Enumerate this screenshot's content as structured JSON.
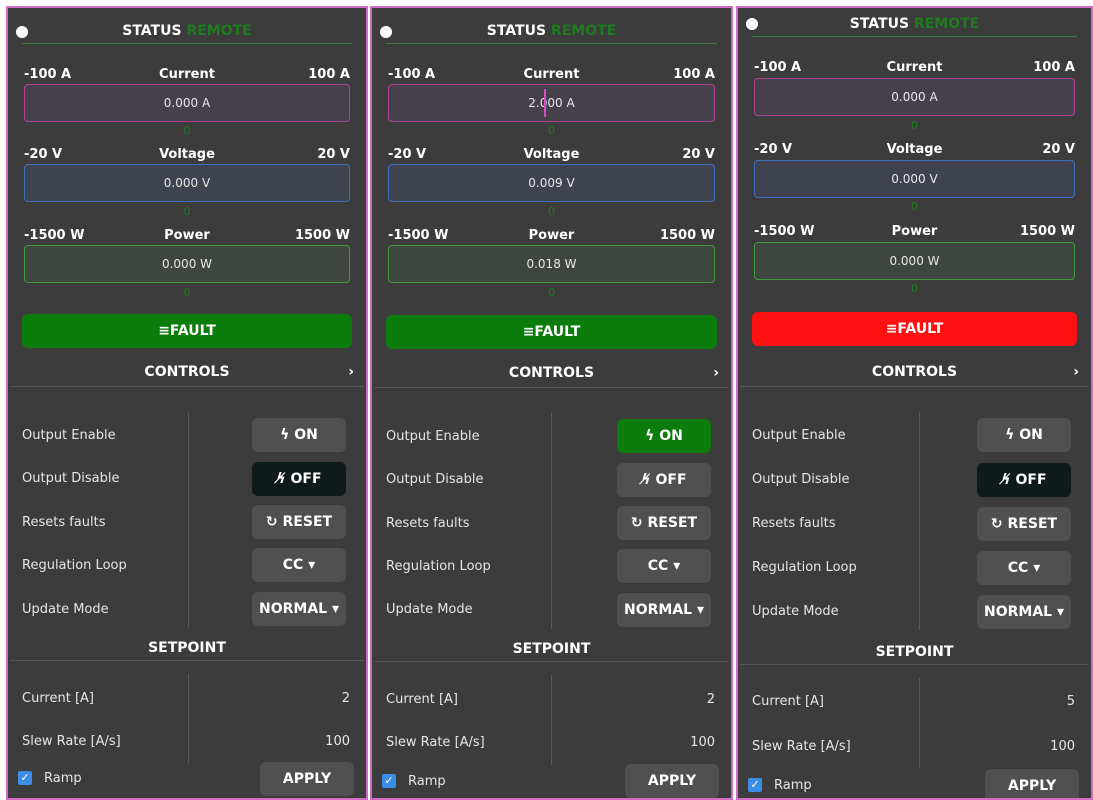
{
  "panels": [
    {
      "status": {
        "title": "STATUS",
        "mode": "REMOTE"
      },
      "gauges": [
        {
          "min": "-100 A",
          "title": "Current",
          "max": "100 A",
          "value": "0.000 A",
          "zero": "0"
        },
        {
          "min": "-20 V",
          "title": "Voltage",
          "max": "20 V",
          "value": "0.000 V",
          "zero": "0"
        },
        {
          "min": "-1500 W",
          "title": "Power",
          "max": "1500 W",
          "value": "0.000 W",
          "zero": "0"
        }
      ],
      "fault": {
        "label": "FAULT",
        "icon": "list-icon",
        "color": "#0c7c0c"
      },
      "controls": {
        "title": "CONTROLS",
        "rows": [
          {
            "label": "Output Enable",
            "button": "ON",
            "icon": "bolt-icon"
          },
          {
            "label": "Output Disable",
            "button": "OFF",
            "icon": "bolt-off-icon"
          },
          {
            "label": "Resets faults",
            "button": "RESET",
            "icon": "reset-icon"
          },
          {
            "label": "Regulation Loop",
            "button": "CC",
            "icon": "caret-down-icon"
          },
          {
            "label": "Update Mode",
            "button": "NORMAL",
            "icon": "caret-down-icon"
          }
        ],
        "active": "OFF"
      },
      "setpoint": {
        "title": "SETPOINT",
        "rows": [
          {
            "label": "Current [A]",
            "value": "2"
          },
          {
            "label": "Slew Rate [A/s]",
            "value": "100"
          }
        ],
        "ramp_label": "Ramp",
        "ramp_checked": true,
        "apply": "APPLY"
      }
    },
    {
      "status": {
        "title": "STATUS",
        "mode": "REMOTE"
      },
      "gauges": [
        {
          "min": "-100 A",
          "title": "Current",
          "max": "100 A",
          "value": "2.000 A",
          "zero": "0"
        },
        {
          "min": "-20 V",
          "title": "Voltage",
          "max": "20 V",
          "value": "0.009 V",
          "zero": "0"
        },
        {
          "min": "-1500 W",
          "title": "Power",
          "max": "1500 W",
          "value": "0.018 W",
          "zero": "0"
        }
      ],
      "fault": {
        "label": "FAULT",
        "icon": "list-icon",
        "color": "#0c7c0c"
      },
      "controls": {
        "title": "CONTROLS",
        "rows": [
          {
            "label": "Output Enable",
            "button": "ON",
            "icon": "bolt-icon"
          },
          {
            "label": "Output Disable",
            "button": "OFF",
            "icon": "bolt-off-icon"
          },
          {
            "label": "Resets faults",
            "button": "RESET",
            "icon": "reset-icon"
          },
          {
            "label": "Regulation Loop",
            "button": "CC",
            "icon": "caret-down-icon"
          },
          {
            "label": "Update Mode",
            "button": "NORMAL",
            "icon": "caret-down-icon"
          }
        ],
        "active": "ON"
      },
      "setpoint": {
        "title": "SETPOINT",
        "rows": [
          {
            "label": "Current [A]",
            "value": "2"
          },
          {
            "label": "Slew Rate [A/s]",
            "value": "100"
          }
        ],
        "ramp_label": "Ramp",
        "ramp_checked": true,
        "apply": "APPLY"
      }
    },
    {
      "status": {
        "title": "STATUS",
        "mode": "REMOTE"
      },
      "gauges": [
        {
          "min": "-100 A",
          "title": "Current",
          "max": "100 A",
          "value": "0.000 A",
          "zero": "0"
        },
        {
          "min": "-20 V",
          "title": "Voltage",
          "max": "20 V",
          "value": "0.000 V",
          "zero": "0"
        },
        {
          "min": "-1500 W",
          "title": "Power",
          "max": "1500 W",
          "value": "0.000 W",
          "zero": "0"
        }
      ],
      "fault": {
        "label": "FAULT",
        "icon": "list-icon",
        "color": "#ff1111"
      },
      "controls": {
        "title": "CONTROLS",
        "rows": [
          {
            "label": "Output Enable",
            "button": "ON",
            "icon": "bolt-icon"
          },
          {
            "label": "Output Disable",
            "button": "OFF",
            "icon": "bolt-off-icon"
          },
          {
            "label": "Resets faults",
            "button": "RESET",
            "icon": "reset-icon"
          },
          {
            "label": "Regulation Loop",
            "button": "CC",
            "icon": "caret-down-icon"
          },
          {
            "label": "Update Mode",
            "button": "NORMAL",
            "icon": "caret-down-icon"
          }
        ],
        "active": "OFF"
      },
      "setpoint": {
        "title": "SETPOINT",
        "rows": [
          {
            "label": "Current [A]",
            "value": "5"
          },
          {
            "label": "Slew Rate [A/s]",
            "value": "100"
          }
        ],
        "ramp_label": "Ramp",
        "ramp_checked": true,
        "apply": "APPLY"
      }
    }
  ]
}
